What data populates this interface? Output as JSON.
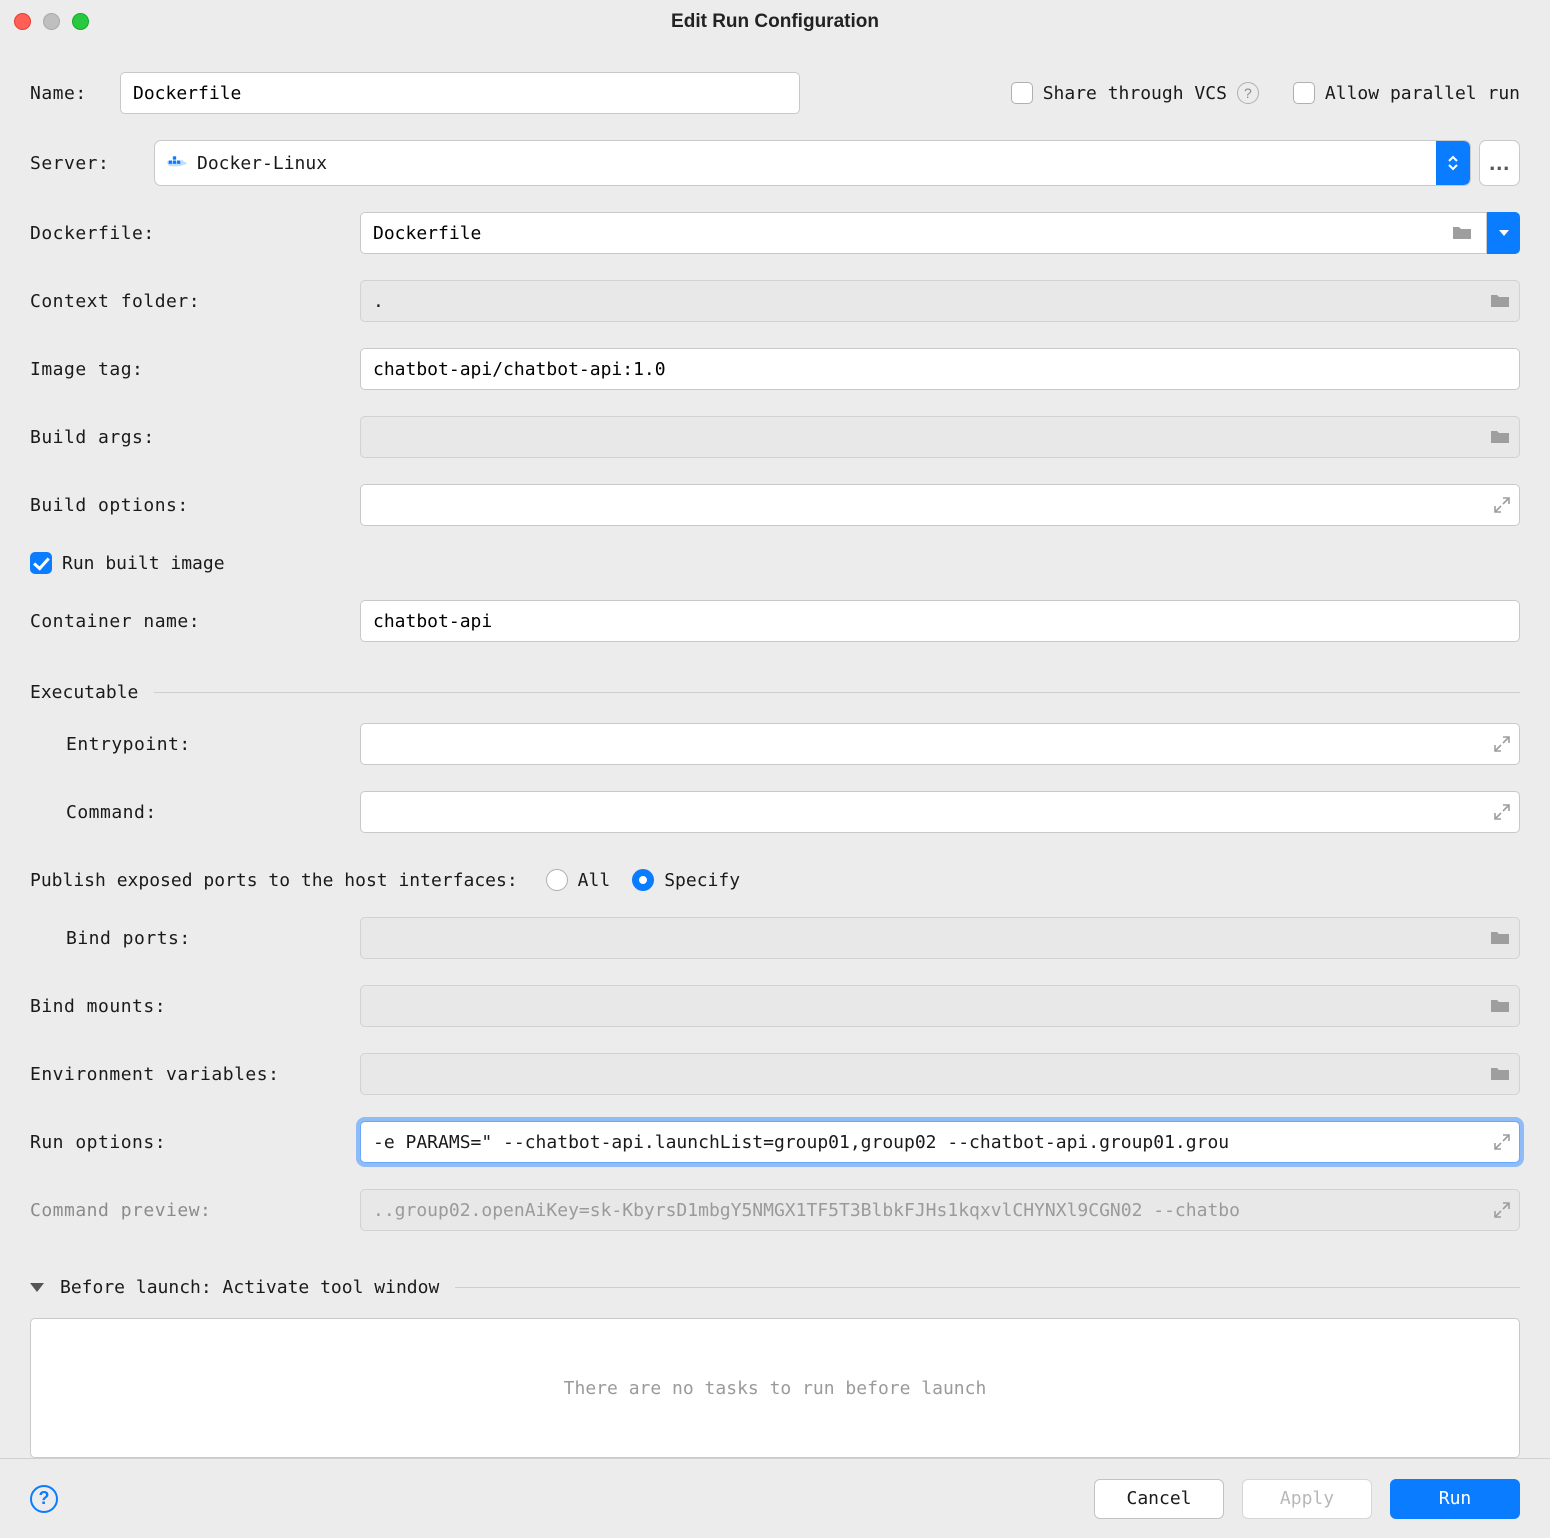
{
  "window": {
    "title": "Edit Run Configuration"
  },
  "top": {
    "name_label": "Name:",
    "name_value": "Dockerfile",
    "share_label": "Share through VCS",
    "parallel_label": "Allow parallel run"
  },
  "server": {
    "label": "Server:",
    "value": "Docker-Linux"
  },
  "fields": {
    "dockerfile_label": "Dockerfile:",
    "dockerfile_value": "Dockerfile",
    "context_label": "Context folder:",
    "context_value": ".",
    "image_tag_label": "Image tag:",
    "image_tag_value": "chatbot-api/chatbot-api:1.0",
    "build_args_label": "Build args:",
    "build_args_value": "",
    "build_options_label": "Build options:",
    "build_options_value": "",
    "run_built_label": "Run built image",
    "container_name_label": "Container name:",
    "container_name_value": "chatbot-api"
  },
  "executable": {
    "section": "Executable",
    "entrypoint_label": "Entrypoint:",
    "entrypoint_value": "",
    "command_label": "Command:",
    "command_value": ""
  },
  "ports": {
    "publish_label": "Publish exposed ports to the host interfaces:",
    "all_label": "All",
    "specify_label": "Specify",
    "bind_ports_label": "Bind ports:",
    "bind_ports_value": ""
  },
  "more": {
    "bind_mounts_label": "Bind mounts:",
    "bind_mounts_value": "",
    "env_label": "Environment variables:",
    "env_value": "",
    "run_options_label": "Run options:",
    "run_options_value": "-e PARAMS=\" --chatbot-api.launchList=group01,group02 --chatbot-api.group01.grou",
    "preview_label": "Command preview:",
    "preview_value": "..group02.openAiKey=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 --chatbo"
  },
  "before_launch": {
    "heading": "Before launch: Activate tool window",
    "empty": "There are no tasks to run before launch"
  },
  "footer": {
    "cancel": "Cancel",
    "apply": "Apply",
    "run": "Run"
  }
}
